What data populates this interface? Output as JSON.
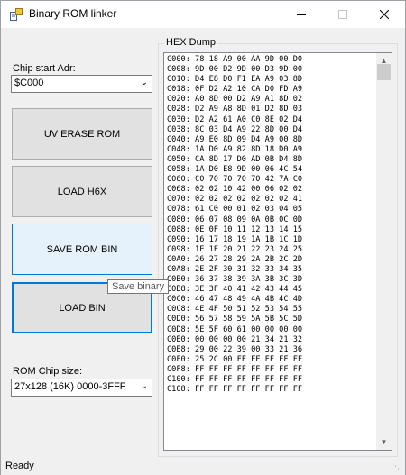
{
  "window": {
    "title": "Binary ROM linker"
  },
  "chip_start": {
    "label": "Chip start Adr:",
    "value": "$C000"
  },
  "buttons": {
    "uv_erase": "UV ERASE ROM",
    "load_h6x": "LOAD H6X",
    "save_rom_bin": "SAVE ROM BIN",
    "load_bin": "LOAD BIN"
  },
  "tooltip": "Save binary",
  "rom_size": {
    "label": "ROM Chip size:",
    "value": "27x128 (16K) 0000-3FFF"
  },
  "hex_dump": {
    "title": "HEX Dump",
    "lines": [
      "C000: 78 18 A9 00 AA 9D 00 D0",
      "C008: 9D 00 D2 9D 00 D3 9D 00",
      "C010: D4 E8 D0 F1 EA A9 03 8D",
      "C018: 0F D2 A2 10 CA D0 FD A9",
      "C020: A0 8D 00 D2 A9 A1 8D 02",
      "C028: D2 A9 A8 8D 01 D2 8D 03",
      "C030: D2 A2 61 A0 C0 8E 02 D4",
      "C038: 8C 03 D4 A9 22 8D 00 D4",
      "C040: A9 E0 8D 09 D4 A9 00 8D",
      "C048: 1A D0 A9 82 8D 18 D0 A9",
      "C050: CA 8D 17 D0 AD 0B D4 8D",
      "C058: 1A D0 E8 9D 00 06 4C 54",
      "C060: C0 70 70 70 70 42 7A C0",
      "C068: 02 02 10 42 00 06 02 02",
      "C070: 02 02 02 02 02 02 02 41",
      "C078: 61 C0 00 01 02 03 04 05",
      "C080: 06 07 08 09 0A 0B 0C 0D",
      "C088: 0E 0F 10 11 12 13 14 15",
      "C090: 16 17 18 19 1A 1B 1C 1D",
      "C098: 1E 1F 20 21 22 23 24 25",
      "C0A0: 26 27 28 29 2A 2B 2C 2D",
      "C0A8: 2E 2F 30 31 32 33 34 35",
      "C0B0: 36 37 38 39 3A 3B 3C 3D",
      "C0B8: 3E 3F 40 41 42 43 44 45",
      "C0C0: 46 47 48 49 4A 4B 4C 4D",
      "C0C8: 4E 4F 50 51 52 53 54 55",
      "C0D0: 56 57 58 59 5A 5B 5C 5D",
      "C0D8: 5E 5F 60 61 00 00 00 00",
      "C0E0: 00 00 00 00 21 34 21 32",
      "C0E8: 29 00 22 39 00 33 21 36",
      "C0F0: 25 2C 00 FF FF FF FF FF",
      "C0F8: FF FF FF FF FF FF FF FF",
      "C100: FF FF FF FF FF FF FF FF",
      "C108: FF FF FF FF FF FF FF FF"
    ]
  },
  "status": {
    "text": "Ready"
  },
  "icons": {
    "app": "app-icon",
    "minimize": "minimize-icon",
    "maximize": "maximize-icon",
    "close": "close-icon",
    "dropdown": "chevron-down-icon"
  },
  "colors": {
    "accent": "#0078d7",
    "window_bg": "#f0f0f0",
    "button_bg": "#e1e1e1"
  }
}
